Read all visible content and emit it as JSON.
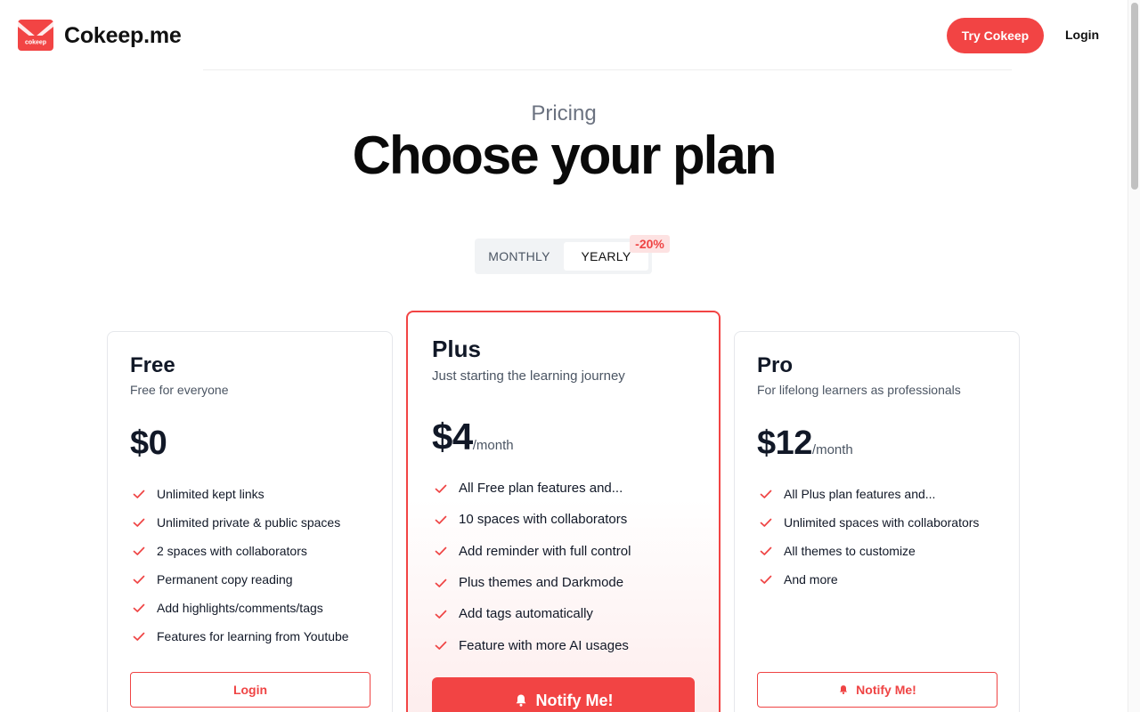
{
  "header": {
    "logo_text": "cokeep",
    "brand": "Cokeep.me",
    "try_button": "Try Cokeep",
    "login_link": "Login"
  },
  "hero": {
    "eyebrow": "Pricing",
    "title": "Choose your plan"
  },
  "billing_toggle": {
    "monthly": "MONTHLY",
    "yearly": "YEARLY",
    "selected": "YEARLY",
    "discount": "-20%"
  },
  "plans": [
    {
      "name": "Free",
      "description": "Free for everyone",
      "price": "$0",
      "unit": "",
      "features": [
        "Unlimited kept links",
        "Unlimited private & public spaces",
        "2 spaces with collaborators",
        "Permanent copy reading",
        "Add highlights/comments/tags",
        "Features for learning from Youtube"
      ],
      "button": "Login"
    },
    {
      "name": "Plus",
      "description": "Just starting the learning journey",
      "price": "$4",
      "unit": "/month",
      "features": [
        "All Free plan features and...",
        "10 spaces with collaborators",
        "Add reminder with full control",
        "Plus themes and Darkmode",
        "Add tags automatically",
        "Feature with more AI usages"
      ],
      "button": "Notify Me!"
    },
    {
      "name": "Pro",
      "description": "For lifelong learners as professionals",
      "price": "$12",
      "unit": "/month",
      "features": [
        "All Plus plan features and...",
        "Unlimited spaces with collaborators",
        "All themes to customize",
        "And more"
      ],
      "button": "Notify Me!"
    }
  ],
  "colors": {
    "accent": "#f24444",
    "badge_bg": "#fde2e2",
    "text_muted": "#6b7280"
  },
  "icons": {
    "check": "check-icon",
    "bell": "bell-icon",
    "logo": "cokeep-logo-icon"
  }
}
